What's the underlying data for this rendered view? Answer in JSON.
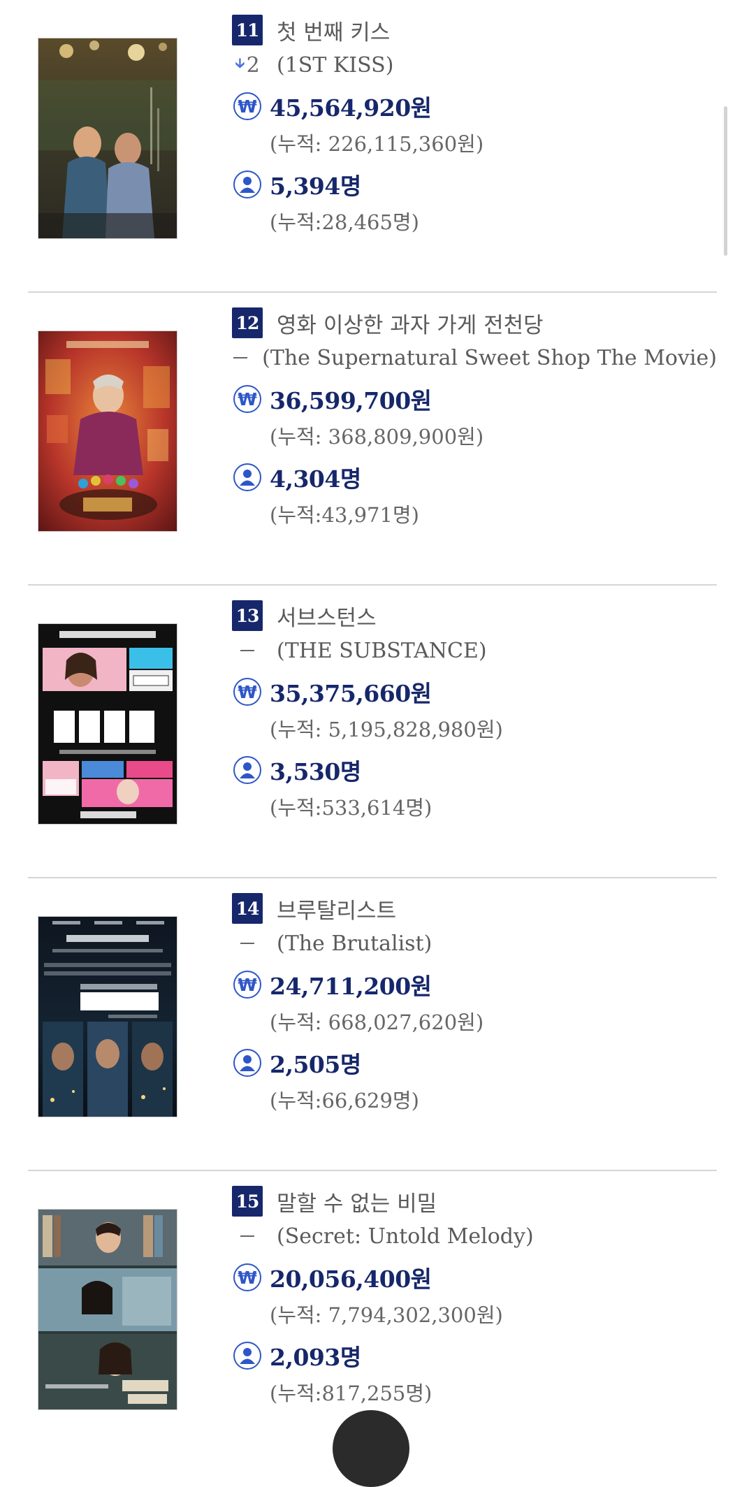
{
  "movies": [
    {
      "rank": "11",
      "change_value": "2",
      "change_dir": "down",
      "title_ko": "첫 번째 키스",
      "title_en": "(1ST KISS)",
      "sales": "45,564,920원",
      "sales_cum": "(누적: 226,115,360원)",
      "audience": "5,394명",
      "audience_cum": "(누적:28,465명)"
    },
    {
      "rank": "12",
      "change_value": "",
      "change_dir": "none",
      "title_ko": "영화 이상한 과자 가게 전천당",
      "title_en": "(The Supernatural Sweet Shop The Movie)",
      "sales": "36,599,700원",
      "sales_cum": "(누적: 368,809,900원)",
      "audience": "4,304명",
      "audience_cum": "(누적:43,971명)"
    },
    {
      "rank": "13",
      "change_value": "",
      "change_dir": "none",
      "title_ko": "서브스턴스",
      "title_en": "(THE SUBSTANCE)",
      "sales": "35,375,660원",
      "sales_cum": "(누적: 5,195,828,980원)",
      "audience": "3,530명",
      "audience_cum": "(누적:533,614명)"
    },
    {
      "rank": "14",
      "change_value": "",
      "change_dir": "none",
      "title_ko": "브루탈리스트",
      "title_en": "(The Brutalist)",
      "sales": "24,711,200원",
      "sales_cum": "(누적: 668,027,620원)",
      "audience": "2,505명",
      "audience_cum": "(누적:66,629명)"
    },
    {
      "rank": "15",
      "change_value": "",
      "change_dir": "none",
      "title_ko": "말할 수 없는 비밀",
      "title_en": "(Secret: Untold Melody)",
      "sales": "20,056,400원",
      "sales_cum": "(누적: 7,794,302,300원)",
      "audience": "2,093명",
      "audience_cum": "(누적:817,255명)"
    }
  ],
  "icons": {
    "sales": "won-circle-icon",
    "audience": "person-circle-icon",
    "rank_down": "arrow-down-icon",
    "rank_same": "dash-icon"
  },
  "colors": {
    "badge": "#16276b",
    "icon_accent": "#2e56c8",
    "rank_down_arrow": "#4f72d8",
    "value_text": "#16276b",
    "divider": "#d6d6d6",
    "fab": "#2b2b2b"
  }
}
